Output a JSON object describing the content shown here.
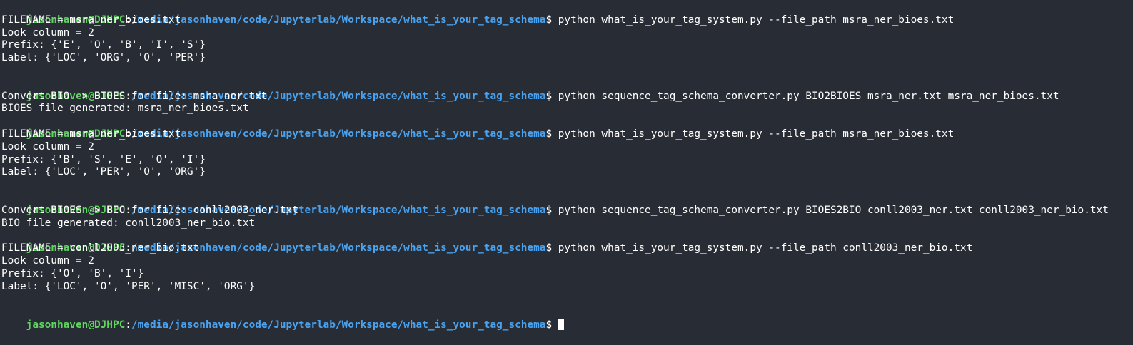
{
  "colors": {
    "background": "#282c34",
    "user_host": "#5fd75f",
    "path": "#4aa3f0",
    "text": "#ffffff"
  },
  "prompt": {
    "user_host": "jasonhaven@DJHPC",
    "colon": ":",
    "path": "/media/jasonhaven/code/Jupyterlab/Workspace/what_is_your_tag_schema",
    "dollar": "$ "
  },
  "lines": [
    {
      "type": "prompt",
      "command": "python what_is_your_tag_system.py --file_path msra_ner_bioes.txt"
    },
    {
      "type": "output",
      "text": "FILENAME = msra_ner_bioes.txt"
    },
    {
      "type": "output",
      "text": "Look column = 2"
    },
    {
      "type": "output",
      "text": "Prefix: {'E', 'O', 'B', 'I', 'S'}"
    },
    {
      "type": "output",
      "text": "Label: {'LOC', 'ORG', 'O', 'PER'}"
    },
    {
      "type": "output",
      "text": ""
    },
    {
      "type": "prompt",
      "command": "python sequence_tag_schema_converter.py BIO2BIOES msra_ner.txt msra_ner_bioes.txt"
    },
    {
      "type": "output",
      "text": "Convert BIO -> BIOES for file: msra_ner.txt"
    },
    {
      "type": "output",
      "text": "BIOES file generated: msra_ner_bioes.txt"
    },
    {
      "type": "prompt",
      "command": "python what_is_your_tag_system.py --file_path msra_ner_bioes.txt"
    },
    {
      "type": "output",
      "text": "FILENAME = msra_ner_bioes.txt"
    },
    {
      "type": "output",
      "text": "Look column = 2"
    },
    {
      "type": "output",
      "text": "Prefix: {'B', 'S', 'E', 'O', 'I'}"
    },
    {
      "type": "output",
      "text": "Label: {'LOC', 'PER', 'O', 'ORG'}"
    },
    {
      "type": "output",
      "text": ""
    },
    {
      "type": "prompt",
      "command": "python sequence_tag_schema_converter.py BIOES2BIO conll2003_ner.txt conll2003_ner_bio.txt"
    },
    {
      "type": "output",
      "text": "Convert BIOES -> BIO for file: conll2003_ner.txt"
    },
    {
      "type": "output",
      "text": "BIO file generated: conll2003_ner_bio.txt"
    },
    {
      "type": "prompt",
      "command": "python what_is_your_tag_system.py --file_path conll2003_ner_bio.txt"
    },
    {
      "type": "output",
      "text": "FILENAME = conll2003_ner_bio.txt"
    },
    {
      "type": "output",
      "text": "Look column = 2"
    },
    {
      "type": "output",
      "text": "Prefix: {'O', 'B', 'I'}"
    },
    {
      "type": "output",
      "text": "Label: {'LOC', 'O', 'PER', 'MISC', 'ORG'}"
    },
    {
      "type": "output",
      "text": ""
    },
    {
      "type": "active-prompt",
      "command": ""
    }
  ]
}
